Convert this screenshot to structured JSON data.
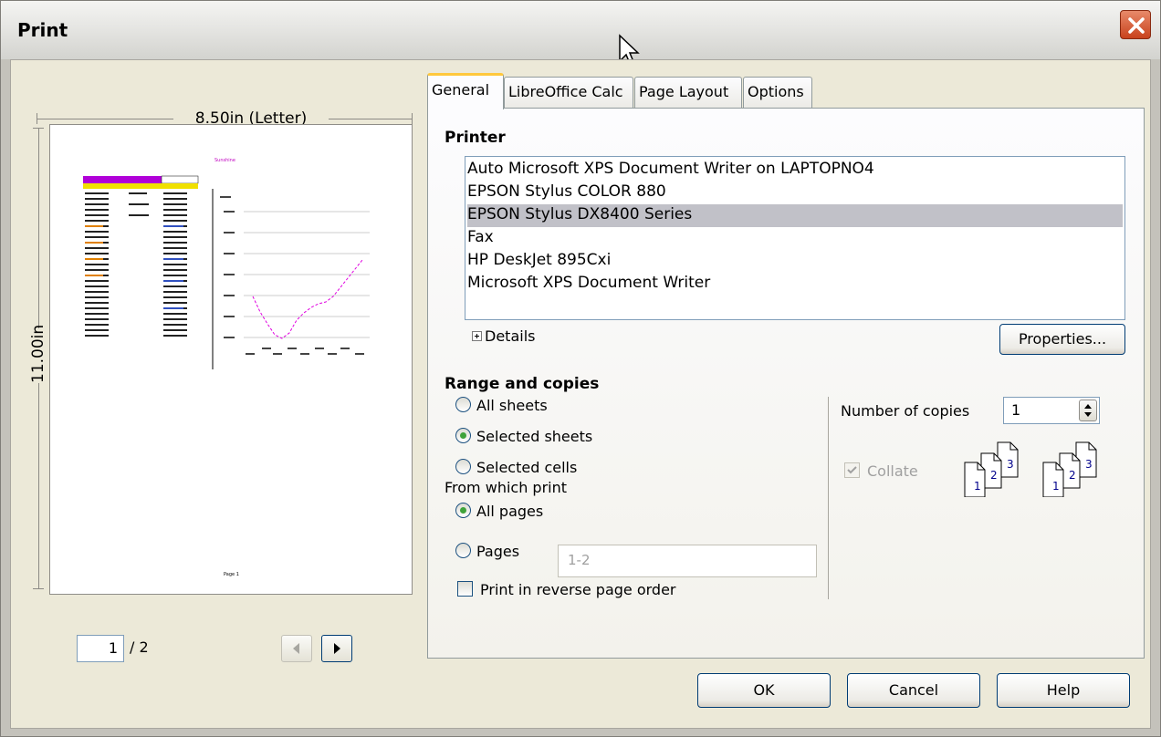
{
  "window": {
    "title": "Print"
  },
  "preview": {
    "width_label": "8.50in (Letter)",
    "height_label": "11.00in",
    "page_current": "1",
    "page_total": "/ 2",
    "mini_title": "Sunshine",
    "mini_footer": "Page 1"
  },
  "tabs": [
    {
      "label": "General",
      "active": true
    },
    {
      "label": "LibreOffice Calc",
      "active": false
    },
    {
      "label": "Page Layout",
      "active": false
    },
    {
      "label": "Options",
      "active": false
    }
  ],
  "printer": {
    "section_title": "Printer",
    "items": [
      {
        "label": "Auto Microsoft XPS Document Writer on LAPTOPNO4",
        "selected": false
      },
      {
        "label": "EPSON Stylus COLOR 880",
        "selected": false
      },
      {
        "label": "EPSON Stylus DX8400 Series",
        "selected": true
      },
      {
        "label": "Fax",
        "selected": false
      },
      {
        "label": "HP DeskJet 895Cxi",
        "selected": false
      },
      {
        "label": "Microsoft XPS Document Writer",
        "selected": false
      }
    ],
    "details_label": "Details",
    "properties_label": "Properties..."
  },
  "range": {
    "section_title": "Range and copies",
    "all_sheets": "All sheets",
    "selected_sheets": "Selected sheets",
    "selected_cells": "Selected cells",
    "from_which_print": "From which print",
    "all_pages": "All pages",
    "pages": "Pages",
    "pages_placeholder": "1-2",
    "reverse_order": "Print in reverse page order",
    "selected_option": "Selected sheets",
    "selected_page_option": "All pages"
  },
  "copies": {
    "label": "Number of copies",
    "value": "1",
    "collate_label": "Collate",
    "collate_checked": true
  },
  "buttons": {
    "ok": "OK",
    "cancel": "Cancel",
    "help": "Help"
  }
}
